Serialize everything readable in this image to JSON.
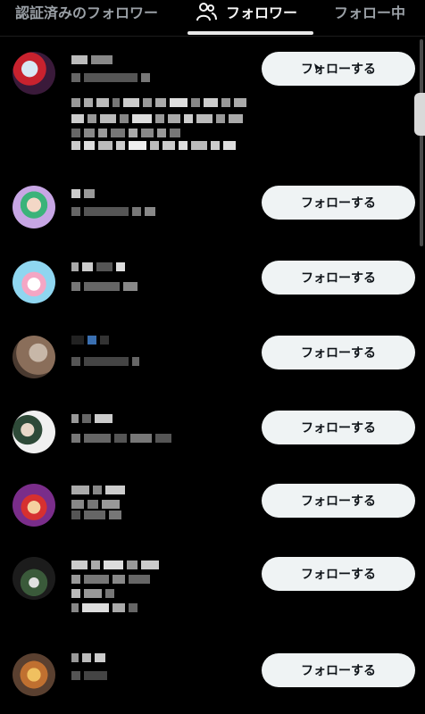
{
  "tabs": {
    "verified_label": "認証済みのフォロワー",
    "followers_label": "フォロワー",
    "following_label": "フォロー中"
  },
  "follow_label": "フォローする",
  "colors": {
    "background": "#000000",
    "button_bg": "#eff3f4",
    "button_text": "#0f1419",
    "active_tab": "#f5f5f5",
    "inactive_tab": "#9aa0a6"
  },
  "rows": [
    {
      "id": 1,
      "follow_label": "フォローする",
      "avatar": "anime-character-red"
    },
    {
      "id": 2,
      "follow_label": "フォローする",
      "avatar": "green-hair-girl"
    },
    {
      "id": 3,
      "follow_label": "フォローする",
      "avatar": "pink-mascot"
    },
    {
      "id": 4,
      "follow_label": "フォローする",
      "avatar": "brown-hair-photo"
    },
    {
      "id": 5,
      "follow_label": "フォローする",
      "avatar": "illustrated-pair"
    },
    {
      "id": 6,
      "follow_label": "フォローする",
      "avatar": "pirate-character"
    },
    {
      "id": 7,
      "follow_label": "フォローする",
      "avatar": "dark-character"
    },
    {
      "id": 8,
      "follow_label": "フォローする",
      "avatar": "drink-photo"
    }
  ]
}
